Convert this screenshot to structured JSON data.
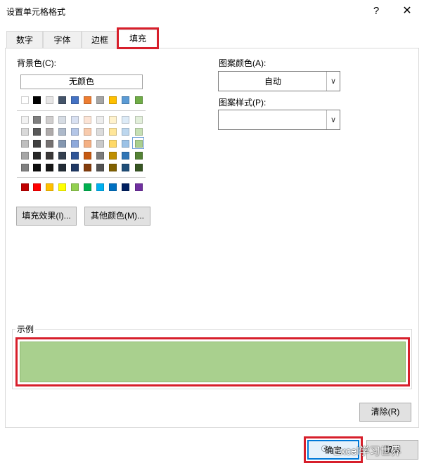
{
  "window": {
    "title": "设置单元格格式",
    "help": "?",
    "close": "✕"
  },
  "tabs": [
    {
      "label": "数字"
    },
    {
      "label": "字体"
    },
    {
      "label": "边框"
    },
    {
      "label": "填充",
      "active": true
    }
  ],
  "fill": {
    "bg_label": "背景色(C):",
    "no_color": "无颜色",
    "theme_top_row": [
      "#ffffff",
      "#000000",
      "#e7e6e6",
      "#44546a",
      "#4472c4",
      "#ed7d31",
      "#a5a5a5",
      "#ffc000",
      "#5b9bd5",
      "#70ad47"
    ],
    "theme_shades": [
      [
        "#f2f2f2",
        "#7f7f7f",
        "#d0cece",
        "#d6dce4",
        "#d9e1f2",
        "#fce4d6",
        "#ededed",
        "#fff2cc",
        "#ddebf7",
        "#e2efda"
      ],
      [
        "#d9d9d9",
        "#595959",
        "#aeaaaa",
        "#adb9ca",
        "#b4c6e7",
        "#f8cbad",
        "#dbdbdb",
        "#ffe699",
        "#bdd7ee",
        "#c6e0b4"
      ],
      [
        "#bfbfbf",
        "#404040",
        "#757171",
        "#8497b0",
        "#8ea9db",
        "#f4b084",
        "#c9c9c9",
        "#ffd966",
        "#9bc2e6",
        "#a9d08e"
      ],
      [
        "#a6a6a6",
        "#262626",
        "#3a3838",
        "#333f4f",
        "#2f5597",
        "#c65911",
        "#7b7b7b",
        "#bf8f00",
        "#2f75b5",
        "#548235"
      ],
      [
        "#808080",
        "#0d0d0d",
        "#161616",
        "#222b35",
        "#1f3864",
        "#833c0c",
        "#525252",
        "#806000",
        "#1f4e78",
        "#375623"
      ]
    ],
    "standard_colors": [
      "#c00000",
      "#ff0000",
      "#ffc000",
      "#ffff00",
      "#92d050",
      "#00b050",
      "#00b0f0",
      "#0070c0",
      "#002060",
      "#7030a0"
    ],
    "selected_color": "#a9d08e",
    "fill_effects_button": "填充效果(I)...",
    "more_colors_button": "其他颜色(M)...",
    "pattern_color_label": "图案颜色(A):",
    "pattern_color_value": "自动",
    "pattern_style_label": "图案样式(P):",
    "pattern_style_value": "",
    "sample_label": "示例",
    "sample_color": "#a9d08e",
    "clear_button": "清除(R)"
  },
  "footer": {
    "ok_button": "确定",
    "cancel_button": "取消",
    "watermark": "Excel学习世界"
  }
}
